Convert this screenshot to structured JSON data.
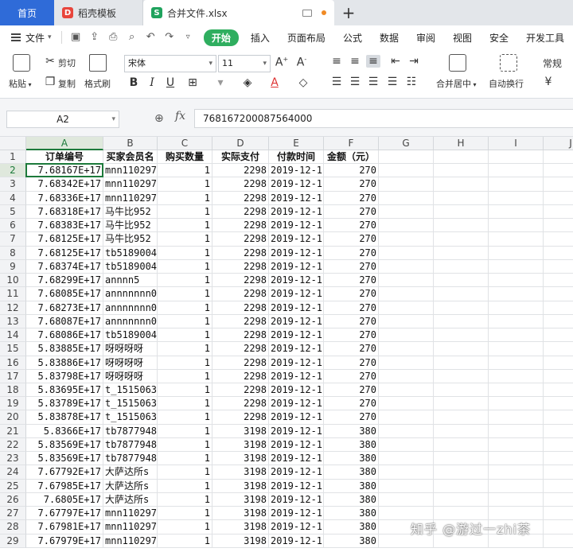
{
  "tabs": {
    "home": "首页",
    "template_icon": "D",
    "template": "稻壳模板",
    "file_icon": "S",
    "file": "合并文件.xlsx",
    "add": "+"
  },
  "menu": {
    "file": "文件",
    "items": [
      "开始",
      "插入",
      "页面布局",
      "公式",
      "数据",
      "审阅",
      "视图",
      "安全",
      "开发工具"
    ]
  },
  "ribbon": {
    "paste": "粘贴",
    "cut": "剪切",
    "copy": "复制",
    "format_painter": "格式刷",
    "font_name": "宋体",
    "font_size": "11",
    "bold": "B",
    "italic": "I",
    "underline": "U",
    "merge_center": "合并居中",
    "wrap": "自动换行",
    "number_format": "常规"
  },
  "formula": {
    "cell_ref": "A2",
    "fx": "fx",
    "value": "768167200087564000"
  },
  "grid": {
    "columns": [
      "A",
      "B",
      "C",
      "D",
      "E",
      "F",
      "G",
      "H",
      "I",
      "J"
    ],
    "headers": [
      "订单编号",
      "买家会员名",
      "购买数量",
      "实际支付",
      "付款时间",
      "金额（元）"
    ],
    "rows": [
      [
        "7.68167E+17",
        "mnn110297",
        "1",
        "2298",
        "2019-12-1",
        "270"
      ],
      [
        "7.68342E+17",
        "mnn110297",
        "1",
        "2298",
        "2019-12-1",
        "270"
      ],
      [
        "7.68336E+17",
        "mnn110297",
        "1",
        "2298",
        "2019-12-1",
        "270"
      ],
      [
        "7.68318E+17",
        "马牛比952",
        "1",
        "2298",
        "2019-12-1",
        "270"
      ],
      [
        "7.68383E+17",
        "马牛比952",
        "1",
        "2298",
        "2019-12-1",
        "270"
      ],
      [
        "7.68125E+17",
        "马牛比952",
        "1",
        "2298",
        "2019-12-1",
        "270"
      ],
      [
        "7.68125E+17",
        "tb5189004",
        "1",
        "2298",
        "2019-12-1",
        "270"
      ],
      [
        "7.68374E+17",
        "tb5189004",
        "1",
        "2298",
        "2019-12-1",
        "270"
      ],
      [
        "7.68299E+17",
        "annnn5",
        "1",
        "2298",
        "2019-12-1",
        "270"
      ],
      [
        "7.68085E+17",
        "annnnnnn0",
        "1",
        "2298",
        "2019-12-1",
        "270"
      ],
      [
        "7.68273E+17",
        "annnnnnn0",
        "1",
        "2298",
        "2019-12-1",
        "270"
      ],
      [
        "7.68087E+17",
        "annnnnnn0",
        "1",
        "2298",
        "2019-12-1",
        "270"
      ],
      [
        "7.68086E+17",
        "tb5189004",
        "1",
        "2298",
        "2019-12-1",
        "270"
      ],
      [
        "5.83885E+17",
        "呀呀呀呀",
        "1",
        "2298",
        "2019-12-1",
        "270"
      ],
      [
        "5.83886E+17",
        "呀呀呀呀",
        "1",
        "2298",
        "2019-12-1",
        "270"
      ],
      [
        "5.83798E+17",
        "呀呀呀呀",
        "1",
        "2298",
        "2019-12-1",
        "270"
      ],
      [
        "5.83695E+17",
        "t_1515063",
        "1",
        "2298",
        "2019-12-1",
        "270"
      ],
      [
        "5.83789E+17",
        "t_1515063",
        "1",
        "2298",
        "2019-12-1",
        "270"
      ],
      [
        "5.83878E+17",
        "t_1515063",
        "1",
        "2298",
        "2019-12-1",
        "270"
      ],
      [
        "5.8366E+17",
        "tb7877948",
        "1",
        "3198",
        "2019-12-1",
        "380"
      ],
      [
        "5.83569E+17",
        "tb7877948",
        "1",
        "3198",
        "2019-12-1",
        "380"
      ],
      [
        "5.83569E+17",
        "tb7877948",
        "1",
        "3198",
        "2019-12-1",
        "380"
      ],
      [
        "7.67792E+17",
        "大萨达所s",
        "1",
        "3198",
        "2019-12-1",
        "380"
      ],
      [
        "7.67985E+17",
        "大萨达所s",
        "1",
        "3198",
        "2019-12-1",
        "380"
      ],
      [
        "7.6805E+17",
        "大萨达所s",
        "1",
        "3198",
        "2019-12-1",
        "380"
      ],
      [
        "7.67797E+17",
        "mnn110297",
        "1",
        "3198",
        "2019-12-1",
        "380"
      ],
      [
        "7.67981E+17",
        "mnn110297",
        "1",
        "3198",
        "2019-12-1",
        "380"
      ],
      [
        "7.67979E+17",
        "mnn110297",
        "1",
        "3198",
        "2019-12-1",
        "380"
      ]
    ]
  },
  "watermark": "知乎 @游过一zhi茶",
  "colors": {
    "accent_green": "#1d7a3b",
    "start_button": "#2fae5f",
    "home_tab": "#2f6bd8"
  }
}
